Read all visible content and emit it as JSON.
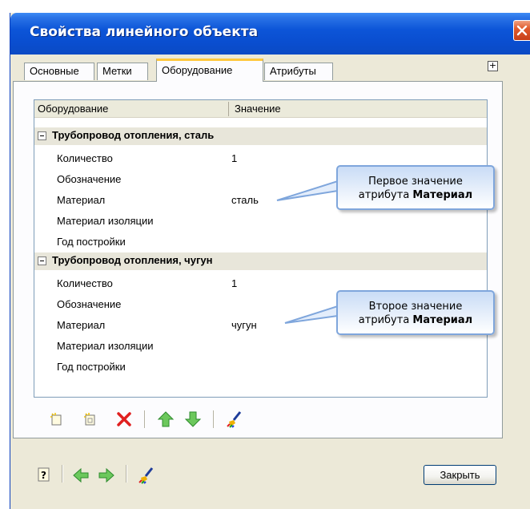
{
  "window": {
    "title": "Свойства линейного объекта"
  },
  "tabs": [
    {
      "label": "Основные"
    },
    {
      "label": "Метки"
    },
    {
      "label": "Оборудование",
      "active": true
    },
    {
      "label": "Атрибуты"
    }
  ],
  "grid": {
    "col_equipment": "Оборудование",
    "col_value": "Значение",
    "groups": [
      {
        "title": "Трубопровод отопления, сталь",
        "rows": [
          {
            "name": "Количество",
            "value": "1"
          },
          {
            "name": "Обозначение",
            "value": ""
          },
          {
            "name": "Материал",
            "value": "сталь"
          },
          {
            "name": "Материал изоляции",
            "value": ""
          },
          {
            "name": "Год постройки",
            "value": ""
          }
        ]
      },
      {
        "title": "Трубопровод отопления, чугун",
        "rows": [
          {
            "name": "Количество",
            "value": "1"
          },
          {
            "name": "Обозначение",
            "value": ""
          },
          {
            "name": "Материал",
            "value": "чугун"
          },
          {
            "name": "Материал изоляции",
            "value": ""
          },
          {
            "name": "Год постройки",
            "value": ""
          }
        ]
      }
    ]
  },
  "callouts": {
    "first_line1": "Первое значение",
    "first_line2_prefix": "атрибута ",
    "first_line2_bold": "Материал",
    "second_line1": "Второе значение",
    "second_line2_prefix": "атрибута ",
    "second_line2_bold": "Материал"
  },
  "icons": {
    "add": "add-item-icon",
    "add2": "add-subitem-icon",
    "delete": "delete-icon",
    "up": "move-up-icon",
    "down": "move-down-icon",
    "brush": "brush-icon",
    "help": "help-icon",
    "back": "back-arrow-icon",
    "forward": "forward-arrow-icon"
  },
  "buttons": {
    "close": "Закрыть"
  },
  "colors": {
    "titlebar": "#0c55d8",
    "window_bg": "#ece9d8",
    "active_tab_accent": "#ffc83c",
    "delete_red": "#e02020",
    "arrow_green": "#4cb848"
  }
}
